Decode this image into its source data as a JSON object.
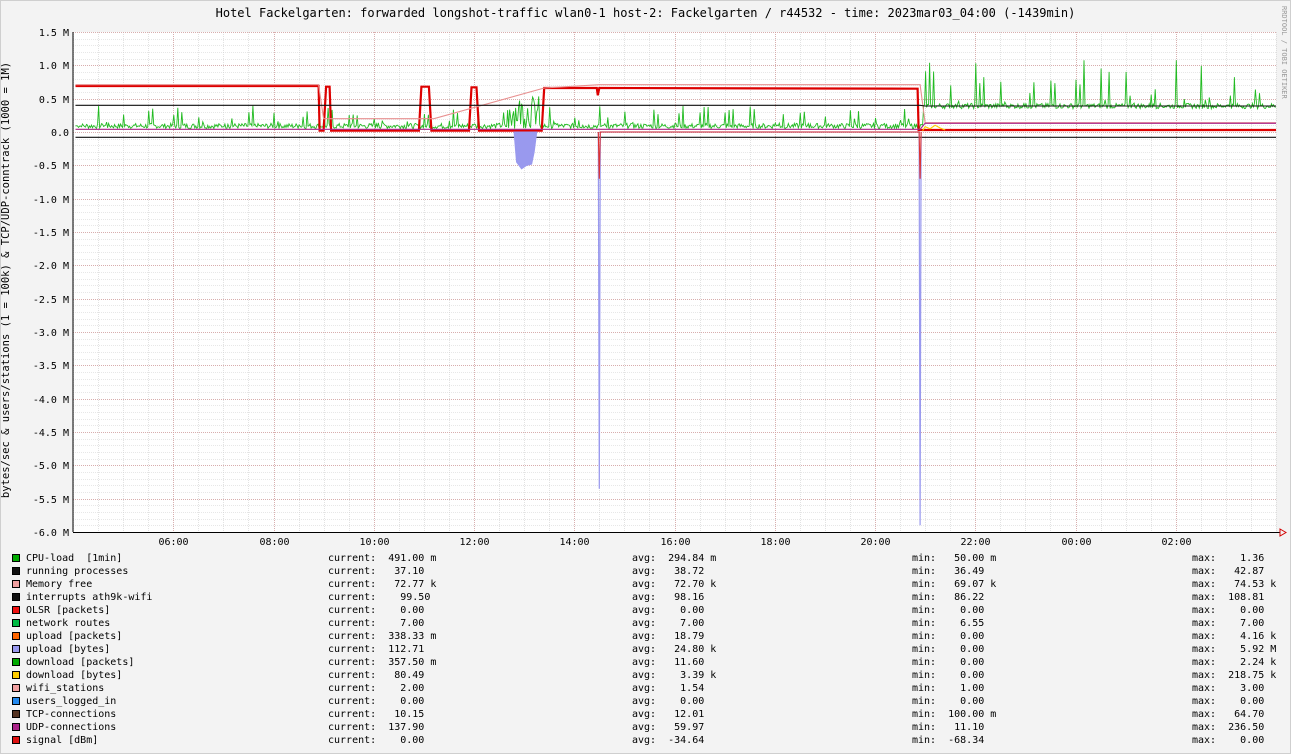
{
  "title": "Hotel Fackelgarten: forwarded longshot-traffic wlan0-1 host-2: Fackelgarten / r44532 - time: 2023mar03_04:00 (-1439min)",
  "vendor": "RRDTOOL / TOBI OETIKER",
  "colors": {
    "background": "#f3f3f3",
    "plot": "#ffffff",
    "grid_minor": "#cfcfcf",
    "grid_major": "#d39a9a",
    "arrow": "#d20000"
  },
  "chart_data": {
    "type": "line",
    "ylabel": "bytes/sec & users/stations (1 = 100k) & TCP/UDP-conntrack (1000 = 1M)",
    "ylim": [
      -6.0,
      1.5
    ],
    "yticks": [
      "1.5 M",
      "1.0 M",
      "0.5 M",
      "0.0",
      "-0.5 M",
      "-1.0 M",
      "-1.5 M",
      "-2.0 M",
      "-2.5 M",
      "-3.0 M",
      "-3.5 M",
      "-4.0 M",
      "-4.5 M",
      "-5.0 M",
      "-5.5 M",
      "-6.0 M"
    ],
    "ytick_values": [
      1.5,
      1.0,
      0.5,
      0.0,
      -0.5,
      -1.0,
      -1.5,
      -2.0,
      -2.5,
      -3.0,
      -3.5,
      -4.0,
      -4.5,
      -5.0,
      -5.5,
      -6.0
    ],
    "xlim": [
      4.0,
      28.0
    ],
    "xticks": [
      "06:00",
      "08:00",
      "10:00",
      "12:00",
      "14:00",
      "16:00",
      "18:00",
      "20:00",
      "22:00",
      "00:00",
      "02:00"
    ],
    "xtick_values": [
      6,
      8,
      10,
      12,
      14,
      16,
      18,
      20,
      22,
      24,
      26
    ],
    "grid": true,
    "series": [
      {
        "name": "OLSR [packets]",
        "color": "#dd0000",
        "x": [
          4.05,
          8.9,
          8.92,
          9.0,
          9.05,
          9.12,
          9.15,
          10.9,
          10.95,
          11.1,
          11.15,
          11.9,
          11.95,
          12.05,
          12.1,
          13.35,
          13.4,
          14.45,
          14.47,
          14.5,
          14.55,
          20.85,
          20.87,
          28.0
        ],
        "y": [
          0.69,
          0.69,
          0.02,
          0.02,
          0.68,
          0.68,
          0.02,
          0.02,
          0.68,
          0.68,
          0.02,
          0.02,
          0.67,
          0.67,
          0.02,
          0.02,
          0.66,
          0.66,
          0.55,
          0.66,
          0.66,
          0.65,
          0.03,
          0.03
        ]
      },
      {
        "name": "Memory free",
        "color": "#e89090",
        "x": [
          4.05,
          8.9,
          9.0,
          9.2,
          11.0,
          11.2,
          13.4,
          14.5,
          20.9,
          21.0,
          28.0
        ],
        "y": [
          0.71,
          0.71,
          0.2,
          0.2,
          0.2,
          0.2,
          0.66,
          0.71,
          0.71,
          0.14,
          0.14
        ]
      },
      {
        "name": "interrupts ath9k-wifi",
        "color": "#111111",
        "x": [
          4.05,
          20.9,
          21.0,
          28.0
        ],
        "y": [
          0.4,
          0.4,
          0.39,
          0.39
        ]
      },
      {
        "name": "running processes",
        "color": "#111111",
        "x": [
          4.05,
          28.0
        ],
        "y": [
          -0.08,
          -0.08
        ]
      },
      {
        "name": "upload [bytes]",
        "color": "#9999ee",
        "x": [
          12.8,
          12.85,
          12.95,
          13.05,
          13.15,
          13.2,
          13.25
        ],
        "y": [
          0.0,
          -0.45,
          -0.55,
          -0.5,
          -0.48,
          -0.3,
          0.0
        ]
      },
      {
        "name": "upload [bytes] spikes",
        "color": "#9999ee",
        "x": [
          14.48,
          14.5,
          14.52,
          20.88,
          20.9,
          20.92
        ],
        "y": [
          0.0,
          -5.35,
          0.0,
          0.0,
          -5.9,
          0.0
        ]
      },
      {
        "name": "signal [dBm]",
        "color": "#dd3333",
        "x": [
          14.48,
          14.5,
          14.52,
          20.88,
          20.9,
          20.92
        ],
        "y": [
          0.0,
          -0.7,
          0.0,
          0.0,
          -0.7,
          0.0
        ]
      },
      {
        "name": "UDP-connections",
        "color": "#aa2288",
        "x": [
          4.05,
          20.9,
          21.0,
          28.0
        ],
        "y": [
          0.04,
          0.04,
          0.13,
          0.13
        ]
      },
      {
        "name": "download [bytes]",
        "color": "#ffcc00",
        "x": [
          20.95,
          21.0,
          21.1,
          21.2,
          21.3,
          21.4
        ],
        "y": [
          0.02,
          0.08,
          0.05,
          0.1,
          0.06,
          0.03
        ]
      }
    ]
  },
  "legend": [
    {
      "name": "CPU-load  [1min]",
      "color": "#00aa00",
      "current": "current:  491.00 m",
      "avg": "avg:  294.84 m",
      "min": "min:   50.00 m",
      "max": "max:    1.36"
    },
    {
      "name": "running processes",
      "color": "#111111",
      "current": "current:   37.10",
      "avg": "avg:   38.72",
      "min": "min:   36.49",
      "max": "max:   42.87"
    },
    {
      "name": "Memory free",
      "color": "#f0a0a0",
      "current": "current:   72.77 k",
      "avg": "avg:   72.70 k",
      "min": "min:   69.07 k",
      "max": "max:   74.53 k"
    },
    {
      "name": "interrupts ath9k-wifi",
      "color": "#111111",
      "current": "current:    99.50",
      "avg": "avg:   98.16",
      "min": "min:   86.22",
      "max": "max:  108.81"
    },
    {
      "name": "OLSR [packets]",
      "color": "#ee1111",
      "current": "current:    0.00",
      "avg": "avg:    0.00",
      "min": "min:    0.00",
      "max": "max:    0.00"
    },
    {
      "name": "network routes",
      "color": "#00bb44",
      "current": "current:    7.00",
      "avg": "avg:    7.00",
      "min": "min:    6.55",
      "max": "max:    7.00"
    },
    {
      "name": "upload [packets]",
      "color": "#ff6600",
      "current": "current:  338.33 m",
      "avg": "avg:   18.79",
      "min": "min:    0.00",
      "max": "max:    4.16 k"
    },
    {
      "name": "upload [bytes]",
      "color": "#9999ee",
      "current": "current:  112.71",
      "avg": "avg:   24.80 k",
      "min": "min:    0.00",
      "max": "max:    5.92 M"
    },
    {
      "name": "download [packets]",
      "color": "#00aa00",
      "current": "current:  357.50 m",
      "avg": "avg:   11.60",
      "min": "min:    0.00",
      "max": "max:    2.24 k"
    },
    {
      "name": "download [bytes]",
      "color": "#ffcc00",
      "current": "current:   80.49",
      "avg": "avg:    3.39 k",
      "min": "min:    0.00",
      "max": "max:  218.75 k"
    },
    {
      "name": "wifi_stations",
      "color": "#f0a0a0",
      "current": "current:    2.00",
      "avg": "avg:    1.54",
      "min": "min:    1.00",
      "max": "max:    3.00"
    },
    {
      "name": "users_logged_in",
      "color": "#2288ee",
      "current": "current:    0.00",
      "avg": "avg:    0.00",
      "min": "min:    0.00",
      "max": "max:    0.00"
    },
    {
      "name": "TCP-connections",
      "color": "#553322",
      "current": "current:   10.15",
      "avg": "avg:   12.01",
      "min": "min:  100.00 m",
      "max": "max:   64.70"
    },
    {
      "name": "UDP-connections",
      "color": "#aa2288",
      "current": "current:  137.90",
      "avg": "avg:   59.97",
      "min": "min:   11.10",
      "max": "max:  236.50"
    },
    {
      "name": "signal [dBm]",
      "color": "#dd1111",
      "current": "current:    0.00",
      "avg": "avg:  -34.64",
      "min": "min:  -68.34",
      "max": "max:    0.00"
    }
  ]
}
